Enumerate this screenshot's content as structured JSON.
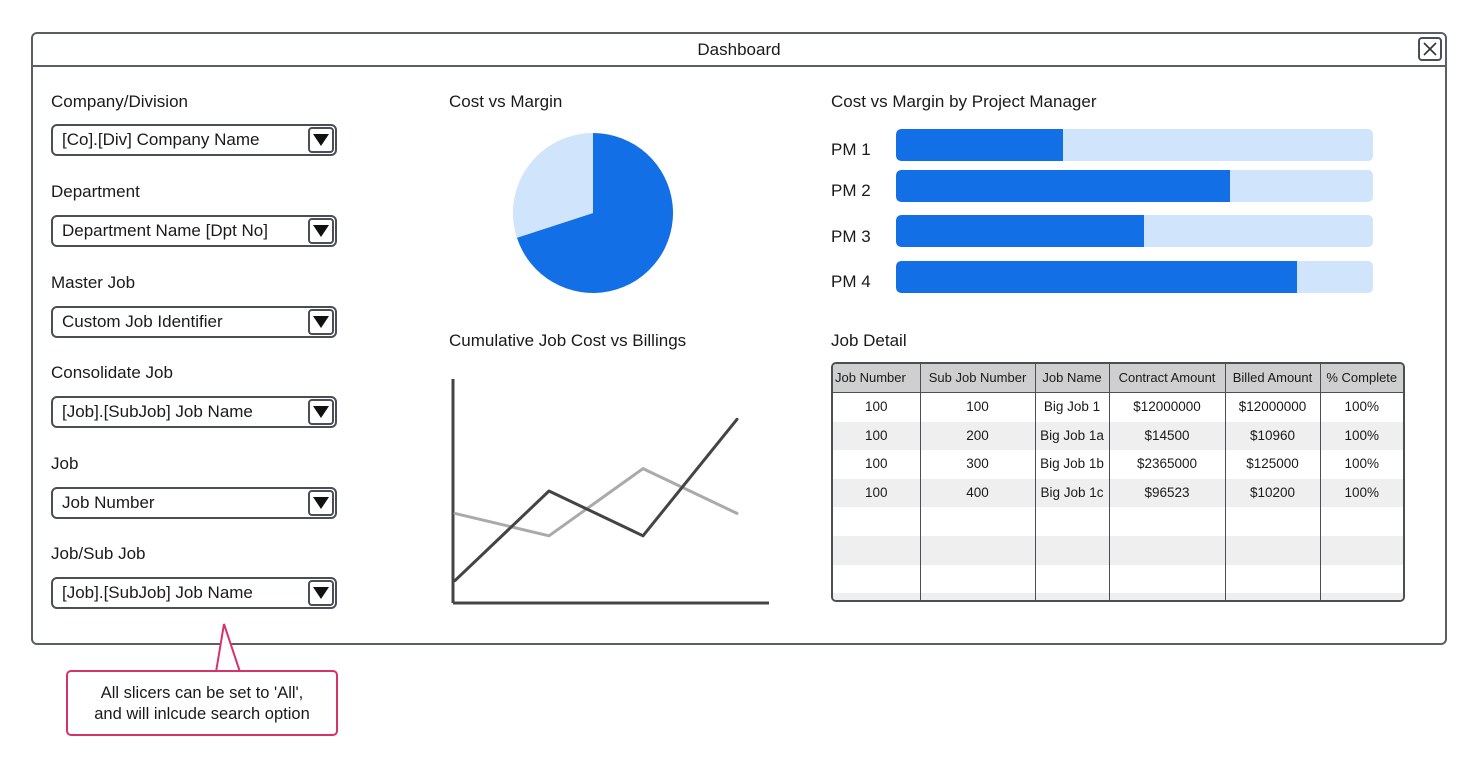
{
  "window": {
    "title": "Dashboard",
    "close_icon": "close-icon"
  },
  "slicers": [
    {
      "label": "Company/Division",
      "value": "[Co].[Div] Company Name"
    },
    {
      "label": "Department",
      "value": "Department Name [Dpt No]"
    },
    {
      "label": "Master Job",
      "value": "Custom Job Identifier"
    },
    {
      "label": "Consolidate Job",
      "value": "[Job].[SubJob] Job Name"
    },
    {
      "label": "Job",
      "value": "Job Number"
    },
    {
      "label": "Job/Sub Job",
      "value": "[Job].[SubJob] Job Name"
    }
  ],
  "charts": {
    "pie_title": "Cost vs Margin",
    "line_title": "Cumulative Job Cost vs Billings",
    "bars_title": "Cost vs Margin by Project Manager",
    "table_title": "Job Detail"
  },
  "chart_data": [
    {
      "type": "pie",
      "title": "Cost vs Margin",
      "slices": [
        {
          "value": 70,
          "color": "#126fe6"
        },
        {
          "value": 30,
          "color": "#d0e4fb"
        }
      ]
    },
    {
      "type": "line",
      "title": "Cumulative Job Cost vs Billings",
      "x": [
        0,
        1,
        2,
        3
      ],
      "ylim": [
        0,
        10
      ],
      "series": [
        {
          "values": [
            1,
            5,
            3,
            8.2
          ],
          "color": "#444444"
        },
        {
          "values": [
            4,
            3,
            6,
            4
          ],
          "color": "#aaaaaa"
        }
      ]
    },
    {
      "type": "bar",
      "title": "Cost vs Margin by Project Manager",
      "categories": [
        "PM 1",
        "PM 2",
        "PM 3",
        "PM 4"
      ],
      "values": [
        0.35,
        0.7,
        0.52,
        0.84
      ],
      "ylim": [
        0,
        1
      ],
      "fill_color": "#126fe6",
      "track_color": "#d0e4fb"
    }
  ],
  "job_detail": {
    "headers": [
      "Job Number",
      "Sub Job Number",
      "Job Name",
      "Contract Amount",
      "Billed Amount",
      "% Complete"
    ],
    "rows": [
      [
        "100",
        "100",
        "Big Job 1",
        "$12000000",
        "$12000000",
        "100%"
      ],
      [
        "100",
        "200",
        "Big Job 1a",
        "$14500",
        "$10960",
        "100%"
      ],
      [
        "100",
        "300",
        "Big Job 1b",
        "$2365000",
        "$125000",
        "100%"
      ],
      [
        "100",
        "400",
        "Big Job 1c",
        "$96523",
        "$10200",
        "100%"
      ],
      [
        "",
        "",
        "",
        "",
        "",
        ""
      ],
      [
        "",
        "",
        "",
        "",
        "",
        ""
      ],
      [
        "",
        "",
        "",
        "",
        "",
        ""
      ],
      [
        "",
        "",
        "",
        "",
        "",
        ""
      ]
    ]
  },
  "callout": {
    "line1": "All slicers can be set to 'All',",
    "line2": "and will inlcude search option"
  },
  "colors": {
    "accent": "#126fe6",
    "accent_light": "#d0e4fb",
    "callout_border": "#d6336c"
  }
}
